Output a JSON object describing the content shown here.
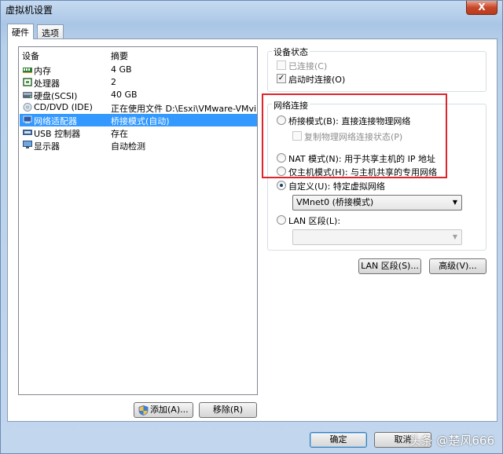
{
  "window": {
    "title": "虚拟机设置",
    "close_glyph": "X"
  },
  "tabs": [
    {
      "label": "硬件",
      "active": true
    },
    {
      "label": "选项",
      "active": false
    }
  ],
  "device_list": {
    "columns": [
      "设备",
      "摘要"
    ],
    "rows": [
      {
        "name": "内存",
        "summary": "4 GB",
        "icon": "memory-icon"
      },
      {
        "name": "处理器",
        "summary": "2",
        "icon": "processor-icon"
      },
      {
        "name": "硬盘(SCSI)",
        "summary": "40 GB",
        "icon": "hard-disk-icon"
      },
      {
        "name": "CD/DVD (IDE)",
        "summary": "正在使用文件 D:\\Esxi\\VMware-VMvi...",
        "icon": "cd-dvd-icon"
      },
      {
        "name": "网络适配器",
        "summary": "桥接模式(自动)",
        "icon": "network-adapter-icon",
        "selected": true
      },
      {
        "name": "USB 控制器",
        "summary": "存在",
        "icon": "usb-controller-icon"
      },
      {
        "name": "显示器",
        "summary": "自动检测",
        "icon": "display-icon"
      }
    ]
  },
  "left_buttons": {
    "add": "添加(A)...",
    "remove": "移除(R)"
  },
  "device_status": {
    "title": "设备状态",
    "connected": {
      "label": "已连接(C)",
      "checked": false,
      "disabled": true
    },
    "connect_at_power_on": {
      "label": "启动时连接(O)",
      "checked": true
    }
  },
  "network": {
    "title": "网络连接",
    "bridged": "桥接模式(B): 直接连接物理网络",
    "replicate": "复制物理网络连接状态(P)",
    "nat": "NAT 模式(N): 用于共享主机的 IP 地址",
    "host_only": "仅主机模式(H): 与主机共享的专用网络",
    "custom": "自定义(U): 特定虚拟网络",
    "custom_value": "VMnet0 (桥接模式)",
    "lan_segment": "LAN 区段(L):",
    "lan_segment_value": "",
    "selected": "custom"
  },
  "right_buttons": {
    "lan_segments": "LAN 区段(S)...",
    "advanced": "高级(V)..."
  },
  "footer": {
    "ok": "确定",
    "cancel": "取消"
  },
  "watermark": "头条 @楚风666",
  "colors": {
    "selection": "#3399ff",
    "highlight_box": "#e0242c"
  }
}
